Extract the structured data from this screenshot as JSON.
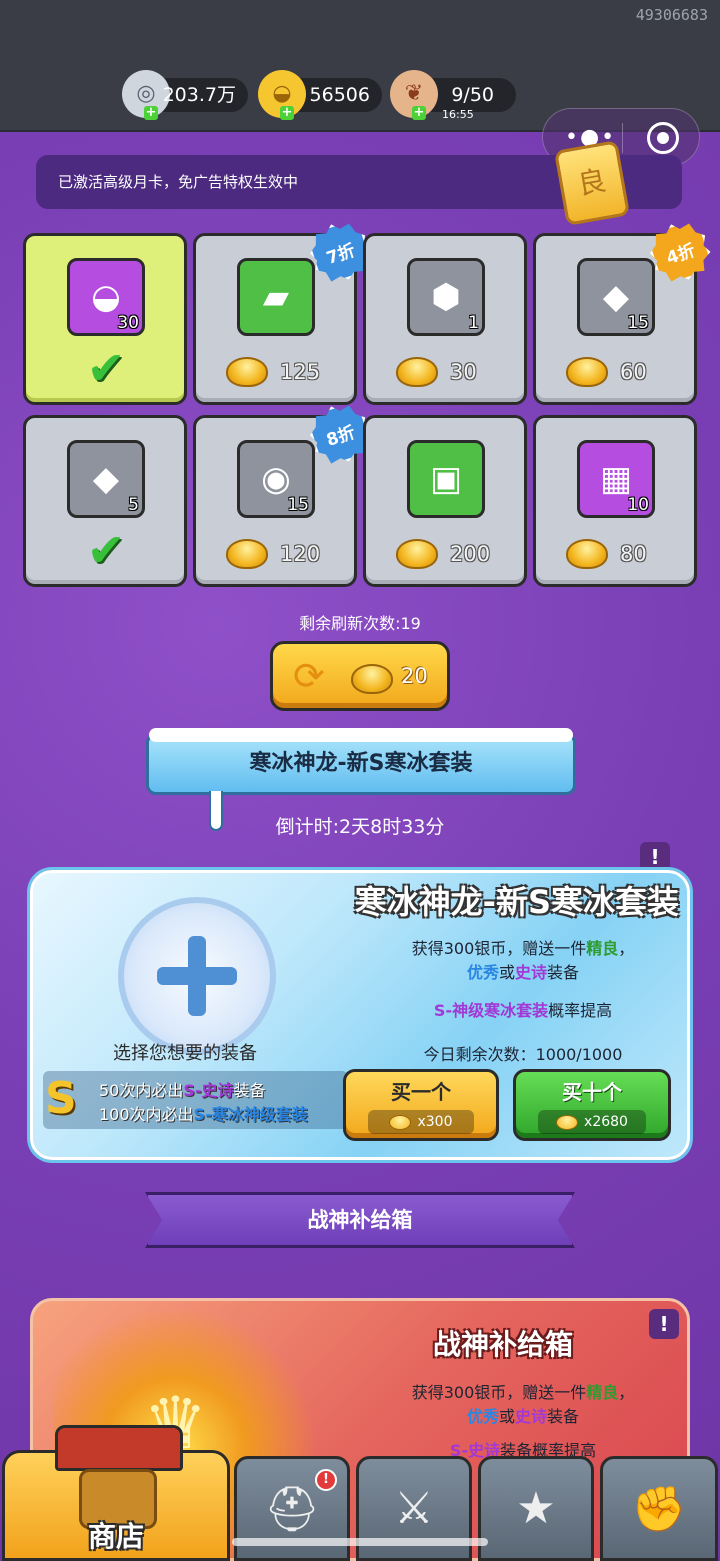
{
  "status_bar": {
    "uid": "49306683"
  },
  "resources": {
    "silver": {
      "value": "203.7万",
      "icon": "silver-coin-icon"
    },
    "gold": {
      "value": "56506",
      "icon": "gold-ingot-icon"
    },
    "stamina": {
      "value": "9/50",
      "timer": "16:55",
      "icon": "meat-icon"
    }
  },
  "notice": {
    "text": "已激活高级月卡，免广告特权生效中"
  },
  "shop_items": [
    {
      "qty": "30",
      "price": "",
      "owned": true,
      "discount": "",
      "frame": "purple",
      "icon": "gold-ingot-icon"
    },
    {
      "qty": "",
      "price": "125",
      "owned": false,
      "discount": "7折",
      "frame": "green",
      "icon": "bracer-icon"
    },
    {
      "qty": "1",
      "price": "30",
      "owned": false,
      "discount": "",
      "frame": "gray",
      "icon": "dragon-badge-icon"
    },
    {
      "qty": "15",
      "price": "60",
      "owned": false,
      "discount": "4折",
      "frame": "gray",
      "icon": "boot-gem-icon"
    },
    {
      "qty": "5",
      "price": "",
      "owned": true,
      "discount": "",
      "frame": "gray",
      "icon": "boot-gem-icon"
    },
    {
      "qty": "15",
      "price": "120",
      "owned": false,
      "discount": "8折",
      "frame": "gray",
      "icon": "medal-gem-icon"
    },
    {
      "qty": "",
      "price": "200",
      "owned": false,
      "discount": "",
      "frame": "green",
      "icon": "armor-icon"
    },
    {
      "qty": "10",
      "price": "80",
      "owned": false,
      "discount": "",
      "frame": "purple",
      "icon": "jade-chest-icon"
    }
  ],
  "refresh": {
    "remaining": "剩余刷新次数:19",
    "cost": "20"
  },
  "event": {
    "banner": "寒冰神龙-新S寒冰套装",
    "countdown": "倒计时:2天8时33分",
    "panel_title": "寒冰神龙-新S寒冰套装",
    "info": "!",
    "desc_a": "获得300银币，赠送一件",
    "desc_fine": "精良",
    "desc_comma": "，",
    "desc_excellent": "优秀",
    "desc_or": "或",
    "desc_epic": "史诗",
    "desc_gear": "装备",
    "rate_highlight": "S-神级寒冰套装",
    "rate_suffix": "概率提高",
    "daily": "今日剩余次数：1000/1000",
    "choose": "选择您想要的装备",
    "guarantee_1_pre": "50次内必出",
    "guarantee_1_hl": "S-史诗",
    "guarantee_1_post": "装备",
    "guarantee_2_pre": "100次内必出",
    "guarantee_2_hl": "S-寒冰神级套装",
    "s_letter": "S",
    "buy_one": {
      "label": "买一个",
      "cost": "x300"
    },
    "buy_ten": {
      "label": "买十个",
      "cost": "x2680"
    }
  },
  "supply": {
    "ribbon": "战神补给箱",
    "title": "战神补给箱",
    "info": "!",
    "desc_a": "获得300银币，赠送一件",
    "desc_fine": "精良",
    "desc_comma": "，",
    "desc_excellent": "优秀",
    "desc_or": "或",
    "desc_epic": "史诗",
    "desc_gear": "装备",
    "rate_highlight": "S-史诗",
    "rate_suffix": "装备概率提高"
  },
  "nav": {
    "shop_label": "商店",
    "badge": "!"
  }
}
